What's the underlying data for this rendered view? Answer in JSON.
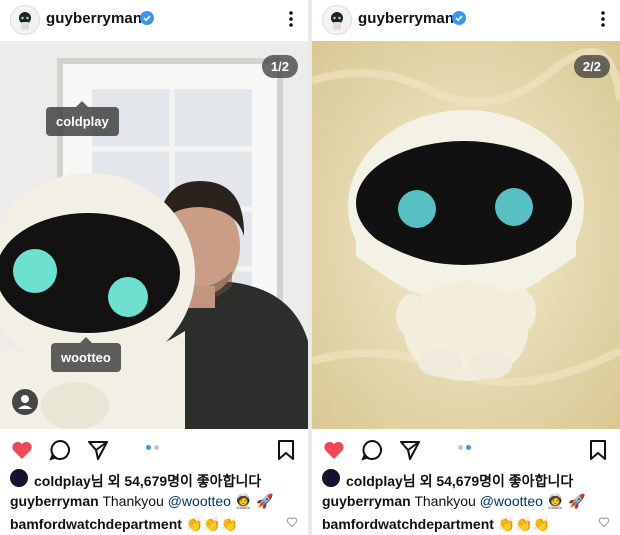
{
  "posts": [
    {
      "username": "guyberryman",
      "counter": "1/2",
      "tags": [
        "coldplay",
        "wootteo"
      ],
      "likes_user": "coldplay",
      "likes_text": "님 외 54,679명이 좋아합니다",
      "caption_user": "guyberryman",
      "caption_text": "Thankyou",
      "caption_mention": "@wootteo",
      "caption_emoji": "🧑‍🚀 🚀",
      "comment_user": "bamfordwatchdepartment",
      "comment_emoji": "👏👏👏"
    },
    {
      "username": "guyberryman",
      "counter": "2/2",
      "likes_user": "coldplay",
      "likes_text": "님 외 54,679명이 좋아합니다",
      "caption_user": "guyberryman",
      "caption_text": "Thankyou",
      "caption_mention": "@wootteo",
      "caption_emoji": "🧑‍🚀 🚀",
      "comment_user": "bamfordwatchdepartment",
      "comment_emoji": "👏👏👏"
    }
  ],
  "icons": {
    "verified": "verified-badge-icon",
    "more": "more-options-icon",
    "like": "heart-icon",
    "comment": "comment-icon",
    "share": "send-icon",
    "save": "bookmark-icon"
  },
  "colors": {
    "like_red": "#ed4956",
    "verified_blue": "#3897f0",
    "mention_blue": "#00376b"
  }
}
